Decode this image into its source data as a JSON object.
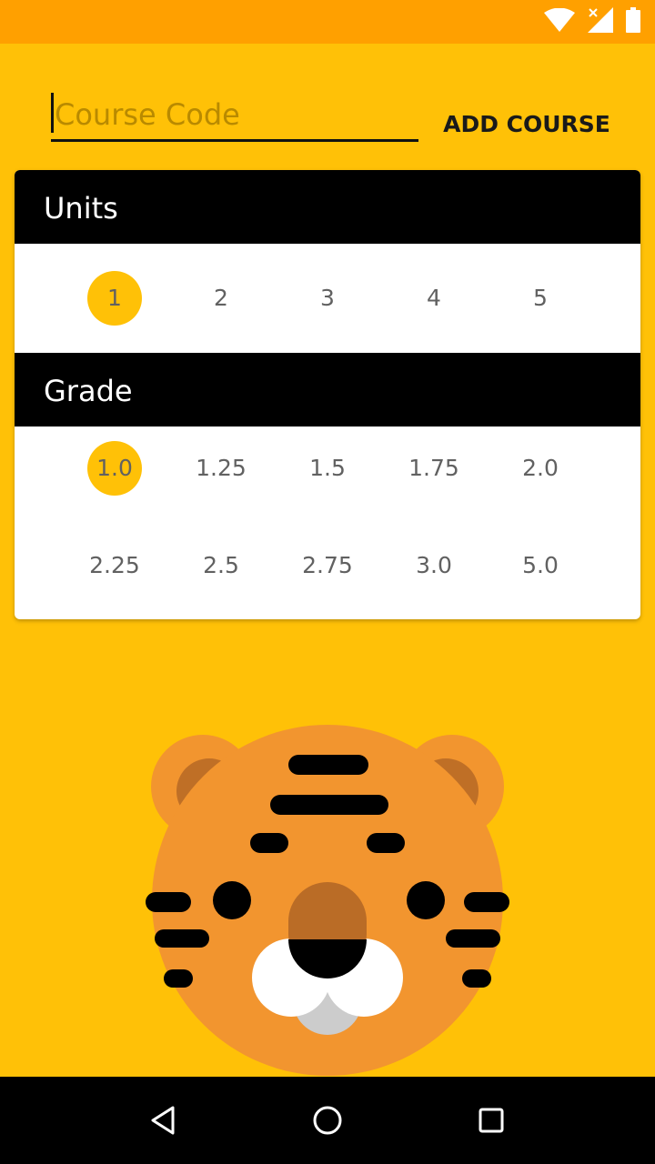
{
  "input": {
    "placeholder": "Course Code",
    "value": ""
  },
  "toolbar": {
    "add_course_label": "ADD COURSE"
  },
  "units": {
    "header": "Units",
    "options": [
      "1",
      "2",
      "3",
      "4",
      "5"
    ],
    "selected": "1"
  },
  "grade": {
    "header": "Grade",
    "options": [
      "1.0",
      "1.25",
      "1.5",
      "1.75",
      "2.0",
      "2.25",
      "2.5",
      "2.75",
      "3.0",
      "5.0"
    ],
    "selected": "1.0"
  },
  "colors": {
    "background": "#FFC107",
    "status_bar": "#FFA000",
    "selected_chip": "#FFC107"
  },
  "icons": [
    "wifi-icon",
    "cellular-icon",
    "battery-icon",
    "tiger-mascot",
    "back-icon",
    "home-icon",
    "recents-icon"
  ]
}
